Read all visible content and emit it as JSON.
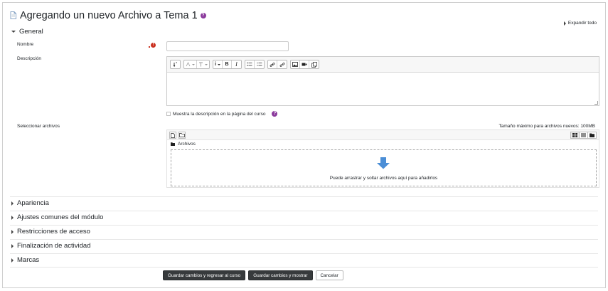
{
  "page": {
    "title": "Agregando un nuevo Archivo a Tema 1",
    "help_symbol": "?",
    "expand_all": "Expandir todo"
  },
  "sections": {
    "general": "General",
    "collapsed": [
      "Apariencia",
      "Ajustes comunes del módulo",
      "Restricciones de acceso",
      "Finalización de actividad",
      "Marcas"
    ]
  },
  "form": {
    "name_label": "Nombre",
    "name_value": "",
    "required_symbol": "!",
    "description_label": "Descripción",
    "description_value": "",
    "show_description_label": "Muestra la descripción en la página del curso",
    "select_files_label": "Seleccionar archivos",
    "max_size_label": "Tamaño máximo para archivos nuevos: 100MB",
    "folder_label": "Archivos",
    "drop_text": "Puede arrastrar y soltar archivos aquí para añadirlos"
  },
  "toolbar": {
    "bold": "B",
    "italic": "I",
    "info": "i"
  },
  "buttons": {
    "save_return": "Guardar cambios y regresar al curso",
    "save_display": "Guardar cambios y mostrar",
    "cancel": "Cancelar"
  },
  "colors": {
    "required": "#ca3120",
    "help": "#8b3a9c",
    "primary_button": "#373a3c",
    "drop_arrow": "#4b8ed6"
  },
  "icons": {
    "title": "document-icon",
    "expand": "triangle-right-icon",
    "collapse": "triangle-down-icon"
  }
}
